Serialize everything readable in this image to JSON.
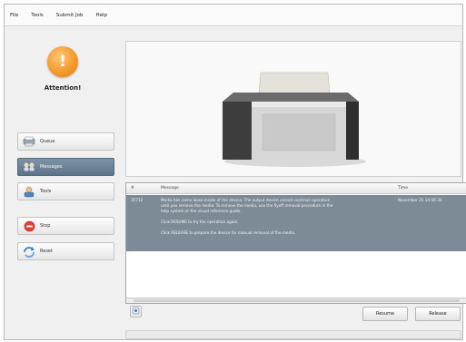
{
  "menu": {
    "items": [
      "File",
      "Tools",
      "Submit Job",
      "Help"
    ]
  },
  "alert": {
    "title": "Attention!",
    "icon": "warning-icon",
    "color": "#f49a2a"
  },
  "sidebar": {
    "items": [
      {
        "label": "Queue",
        "icon": "queue-icon",
        "active": false
      },
      {
        "label": "Messages",
        "icon": "messages-icon",
        "active": true
      },
      {
        "label": "Tools",
        "icon": "tools-icon",
        "active": false
      },
      {
        "label": "Stop",
        "icon": "stop-icon",
        "active": false
      },
      {
        "label": "Reset",
        "icon": "reset-icon",
        "active": false
      }
    ]
  },
  "messages": {
    "columns": [
      "#",
      "Message",
      "Time"
    ],
    "rows": [
      {
        "id": "35712",
        "text": [
          "Media has come loose inside of the device. The output device cannot continue operation",
          "until you remove the media. To remove the media, use the flyoff removal procedure in the",
          "help system or the visual reference guide.",
          "",
          "Click RESUME to try the operation again.",
          "",
          "Click RELEASE to prepare the device for manual removal of the media."
        ],
        "time": "November 25 14:56:30"
      }
    ]
  },
  "actions": {
    "resume": "Resume",
    "release": "Release"
  },
  "colors": {
    "selected_row": "#7d8b97",
    "active_button": "#6a8093"
  }
}
